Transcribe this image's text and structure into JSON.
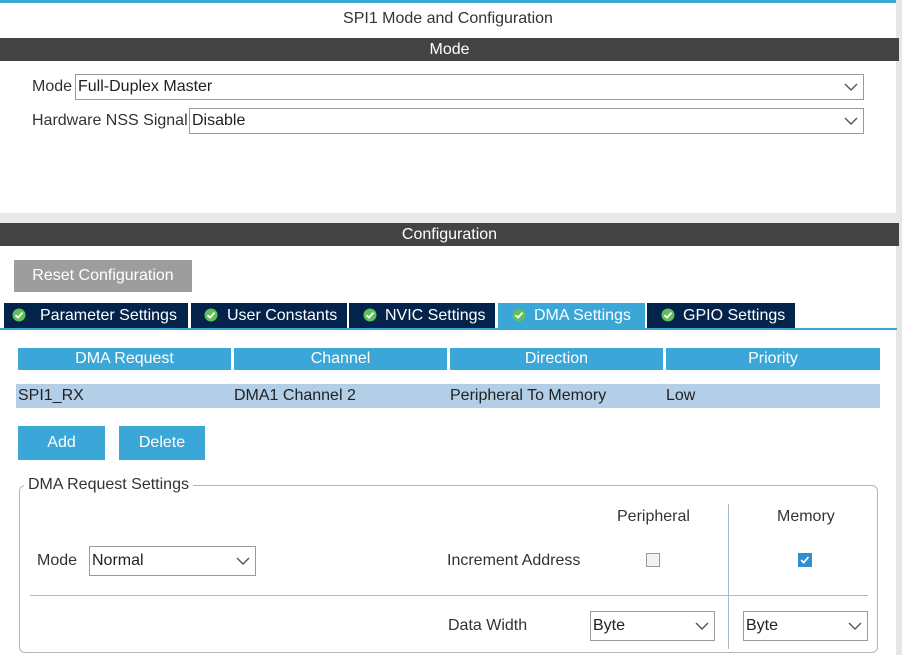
{
  "window": {
    "title": "SPI1 Mode and Configuration"
  },
  "mode_section": {
    "header": "Mode",
    "mode_label": "Mode",
    "mode_value": "Full-Duplex Master",
    "nss_label": "Hardware NSS Signal",
    "nss_value": "Disable"
  },
  "config_section": {
    "header": "Configuration",
    "reset_button": "Reset Configuration",
    "tabs": [
      {
        "label": "Parameter Settings",
        "active": false
      },
      {
        "label": "User Constants",
        "active": false
      },
      {
        "label": "NVIC Settings",
        "active": false
      },
      {
        "label": "DMA Settings",
        "active": true
      },
      {
        "label": "GPIO Settings",
        "active": false
      }
    ]
  },
  "dma_table": {
    "headers": [
      "DMA Request",
      "Channel",
      "Direction",
      "Priority"
    ],
    "rows": [
      [
        "SPI1_RX",
        "DMA1 Channel 2",
        "Peripheral To Memory",
        "Low"
      ]
    ]
  },
  "dma_buttons": {
    "add": "Add",
    "delete": "Delete"
  },
  "request_settings": {
    "title": "DMA Request Settings",
    "mode_label": "Mode",
    "mode_value": "Normal",
    "peripheral_header": "Peripheral",
    "memory_header": "Memory",
    "increment_label": "Increment Address",
    "peripheral_increment": false,
    "memory_increment": true,
    "data_width_label": "Data Width",
    "peripheral_width": "Byte",
    "memory_width": "Byte"
  },
  "colors": {
    "accent": "#3aa7d8",
    "tab_dark": "#03234b",
    "header_dark": "#444444",
    "row_selected": "#b3cfe8"
  },
  "icons": {
    "tab_icon": "check-circle-icon",
    "dropdown": "chevron-down-icon"
  }
}
